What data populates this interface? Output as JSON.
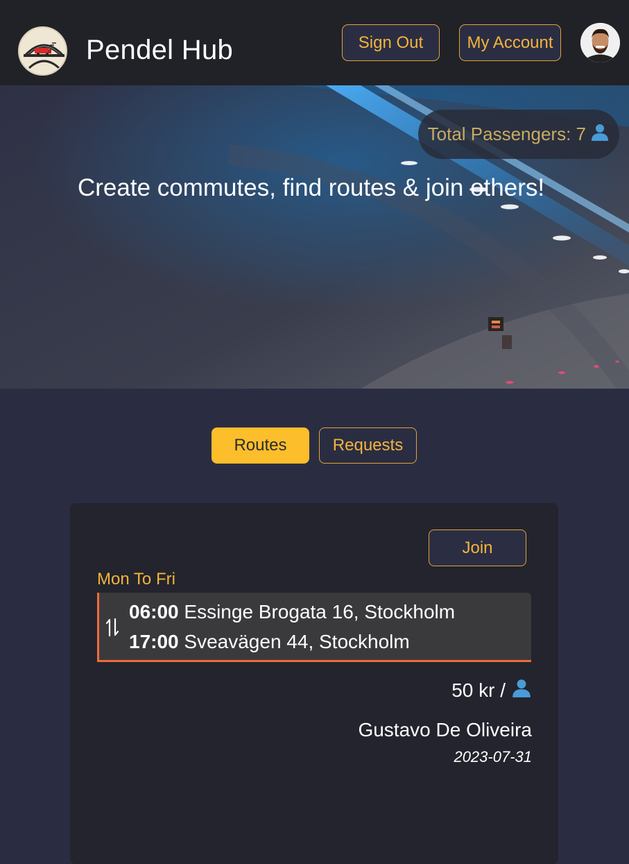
{
  "header": {
    "brand": "Pendel Hub",
    "sign_out_label": "Sign Out",
    "my_account_label": "My Account"
  },
  "hero": {
    "total_passengers_label": "Total Passengers: 7",
    "passenger_icon": "person-icon",
    "tagline": "Create commutes, find routes & join others!"
  },
  "tabs": [
    {
      "label": "Routes",
      "active": true
    },
    {
      "label": "Requests",
      "active": false
    }
  ],
  "route_card": {
    "join_label": "Join",
    "days": "Mon To Fri",
    "swap_icon": "swap-direction-icon",
    "legs": [
      {
        "time": "06:00",
        "address": "Essinge Brogata 16, Stockholm"
      },
      {
        "time": "17:00",
        "address": "Sveavägen 44, Stockholm"
      }
    ],
    "price": "50 kr /",
    "driver_name": "Gustavo De Oliveira",
    "date": "2023-07-31"
  },
  "colors": {
    "accent": "#fdbe2c",
    "accent_border": "#e0a535",
    "route_border": "#ef6b3c",
    "background": "#2a2d42",
    "header": "#212128",
    "card": "#23242d"
  }
}
